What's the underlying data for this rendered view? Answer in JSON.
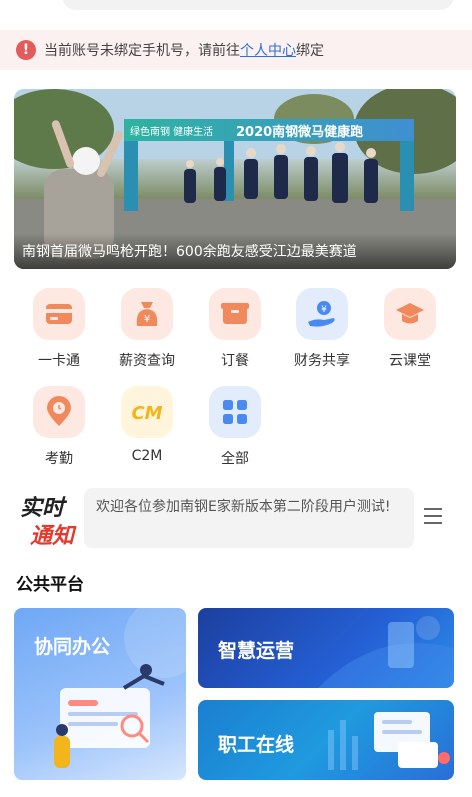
{
  "notice": {
    "text": "当前账号未绑定手机号，请前往",
    "link": "个人中心",
    "tail": "绑定"
  },
  "banner": {
    "caption": "南钢首届微马鸣枪开跑！600余跑友感受江边最美赛道",
    "arch_text": "2020南钢微马健康跑",
    "arch_text_left": "绿色南钢 健康生活"
  },
  "menu": [
    {
      "label": "一卡通",
      "icon": "card-icon",
      "color": "#f08a5d"
    },
    {
      "label": "薪资查询",
      "icon": "money-bag-icon",
      "color": "#f08a5d"
    },
    {
      "label": "订餐",
      "icon": "food-box-icon",
      "color": "#f08a5d"
    },
    {
      "label": "财务共享",
      "icon": "hand-coin-icon",
      "color": "#4a8af0"
    },
    {
      "label": "云课堂",
      "icon": "graduation-cap-icon",
      "color": "#f08a5d"
    },
    {
      "label": "考勤",
      "icon": "location-clock-icon",
      "color": "#f08a5d"
    },
    {
      "label": "C2M",
      "icon": "c2m-logo-icon",
      "color": "#f3b51c"
    },
    {
      "label": "全部",
      "icon": "grid-icon",
      "color": "#4a8af0"
    }
  ],
  "realtime": {
    "logo_line1": "实时",
    "logo_line2": "通知",
    "message": "欢迎各位参加南钢E家新版本第二阶段用户测试!"
  },
  "section_title": "公共平台",
  "platform": {
    "card_a": "协同办公",
    "card_b": "智慧运营",
    "card_c": "职工在线"
  }
}
